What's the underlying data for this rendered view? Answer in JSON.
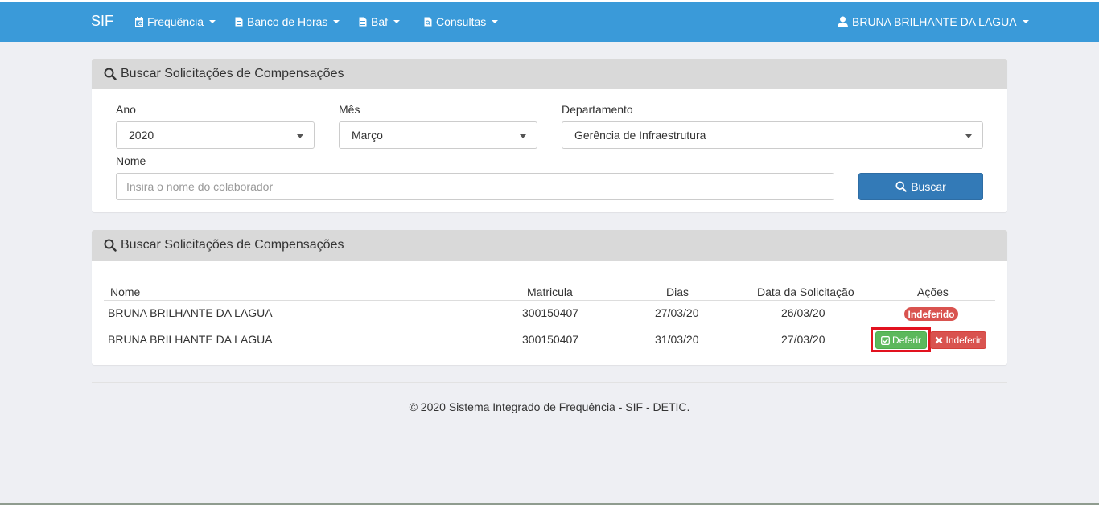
{
  "navbar": {
    "brand": "SIF",
    "items": [
      {
        "label": "Frequência",
        "icon": "calendar-icon"
      },
      {
        "label": "Banco de Horas",
        "icon": "file-icon"
      },
      {
        "label": "Baf",
        "icon": "file-icon"
      },
      {
        "label": "Consultas",
        "icon": "file-search-icon"
      }
    ],
    "user": "BRUNA BRILHANTE DA LAGUA",
    "color": "#3a9ad9"
  },
  "search_panel": {
    "title": "Buscar Solicitações de Compensações",
    "ano_label": "Ano",
    "ano_value": "2020",
    "mes_label": "Mês",
    "mes_value": "Março",
    "departamento_label": "Departamento",
    "departamento_value": "Gerência de Infraestrutura",
    "nome_label": "Nome",
    "nome_placeholder": "Insira o nome do colaborador",
    "buscar_label": "Buscar"
  },
  "results_panel": {
    "title": "Buscar Solicitações de Compensações",
    "columns": [
      "Nome",
      "Matricula",
      "Dias",
      "Data da Solicitação",
      "Ações"
    ],
    "rows": [
      {
        "nome": "BRUNA BRILHANTE DA LAGUA",
        "matricula": "300150407",
        "dias": "27/03/20",
        "data": "26/03/20",
        "status": "Indeferido"
      },
      {
        "nome": "BRUNA BRILHANTE DA LAGUA",
        "matricula": "300150407",
        "dias": "31/03/20",
        "data": "27/03/20",
        "deferir": "Deferir",
        "indeferir": "Indeferir"
      }
    ]
  },
  "footer": "© 2020 Sistema Integrado de Frequência - SIF - DETIC."
}
